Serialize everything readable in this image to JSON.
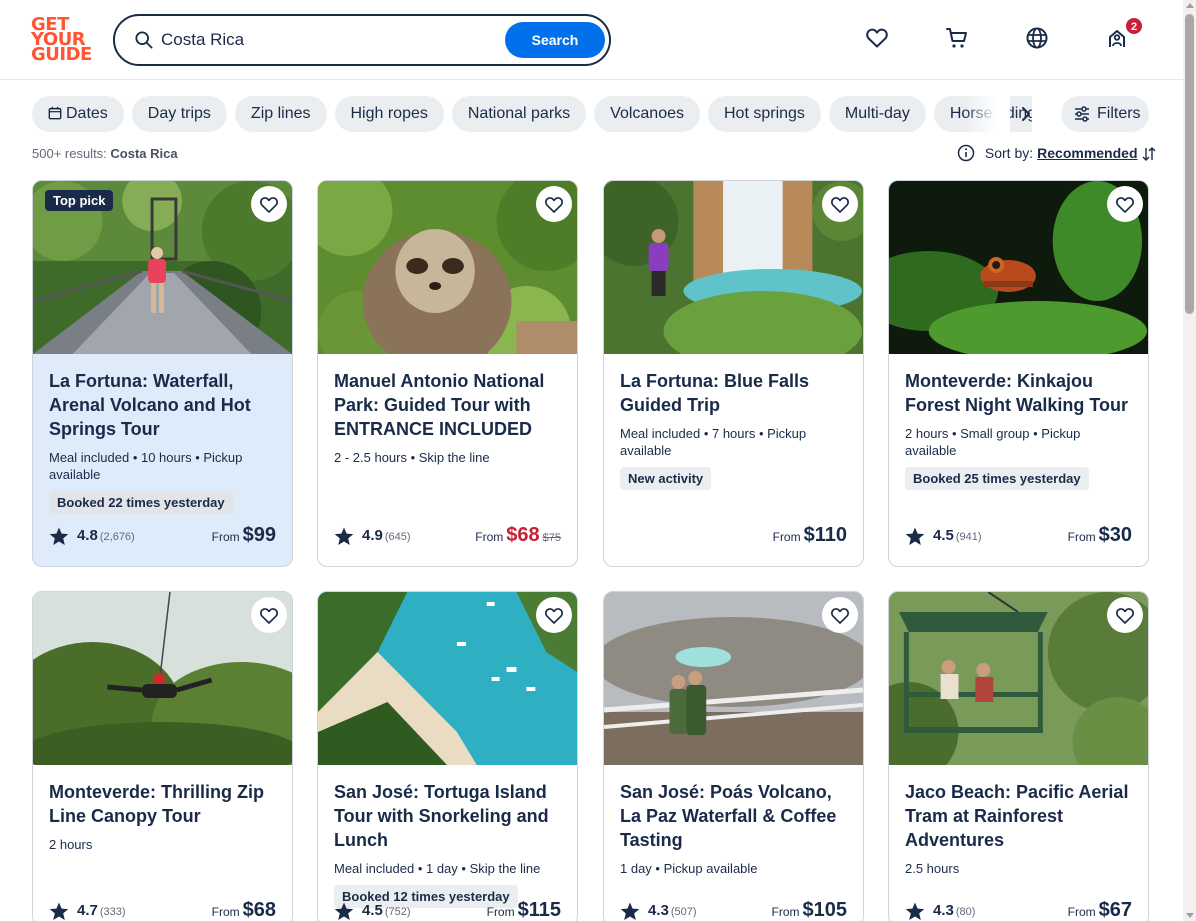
{
  "header": {
    "logo_lines": [
      "GET",
      "YOUR",
      "GUIDE"
    ],
    "search_value": "Costa Rica",
    "search_button": "Search",
    "cart_badge": "2",
    "icons": [
      "wishlist-heart-icon",
      "cart-icon",
      "globe-icon",
      "profile-icon"
    ]
  },
  "chips": [
    "Dates",
    "Day trips",
    "Zip lines",
    "High ropes",
    "National parks",
    "Volcanoes",
    "Hot springs",
    "Multi-day",
    "Horse riding"
  ],
  "filters_label": "Filters",
  "results": {
    "count": "500+ results:",
    "query": "Costa Rica"
  },
  "sort": {
    "label": "Sort by:",
    "value": "Recommended"
  },
  "cards": [
    {
      "title": "La Fortuna: Waterfall, Arenal Volcano and Hot Springs Tour",
      "meta": "Meal included • 10 hours • Pickup available",
      "pill": "Booked 22 times yesterday",
      "rating": "4.8",
      "count": "(2,676)",
      "from": "From",
      "price": "$99",
      "old_price": "",
      "top_pick": "Top pick"
    },
    {
      "title": "Manuel Antonio National Park: Guided Tour with ENTRANCE INCLUDED",
      "meta": "2 - 2.5 hours • Skip the line",
      "pill": "",
      "rating": "4.9",
      "count": "(645)",
      "from": "From",
      "price": "$68",
      "old_price": "$75",
      "top_pick": ""
    },
    {
      "title": "La Fortuna: Blue Falls Guided Trip",
      "meta": "Meal included • 7 hours • Pickup available",
      "pill": "New activity",
      "rating": "",
      "count": "",
      "from": "From",
      "price": "$110",
      "old_price": "",
      "top_pick": ""
    },
    {
      "title": "Monteverde: Kinkajou Forest Night Walking Tour",
      "meta": "2 hours • Small group • Pickup available",
      "pill": "Booked 25 times yesterday",
      "rating": "4.5",
      "count": "(941)",
      "from": "From",
      "price": "$30",
      "old_price": "",
      "top_pick": ""
    },
    {
      "title": "Monteverde: Thrilling Zip Line Canopy Tour",
      "meta": "2 hours",
      "pill": "",
      "rating": "4.7",
      "count": "(333)",
      "from": "From",
      "price": "$68",
      "old_price": "",
      "top_pick": ""
    },
    {
      "title": "San José: Tortuga Island Tour with Snorkeling and Lunch",
      "meta": "Meal included • 1 day • Skip the line",
      "pill": "Booked 12 times yesterday",
      "rating": "4.5",
      "count": "(752)",
      "from": "From",
      "price": "$115",
      "old_price": "",
      "top_pick": ""
    },
    {
      "title": "San José: Poás Volcano, La Paz Waterfall & Coffee Tasting",
      "meta": "1 day • Pickup available",
      "pill": "",
      "rating": "4.3",
      "count": "(507)",
      "from": "From",
      "price": "$105",
      "old_price": "",
      "top_pick": ""
    },
    {
      "title": "Jaco Beach: Pacific Aerial Tram at Rainforest Adventures",
      "meta": "2.5 hours",
      "pill": "",
      "rating": "4.3",
      "count": "(80)",
      "from": "From",
      "price": "$67",
      "old_price": "",
      "top_pick": ""
    }
  ],
  "colors": {
    "brand": "#ff5533",
    "primary": "#0071eb",
    "text": "#1a2b49",
    "sale": "#c71f37",
    "highlight": "#ddebfa"
  }
}
